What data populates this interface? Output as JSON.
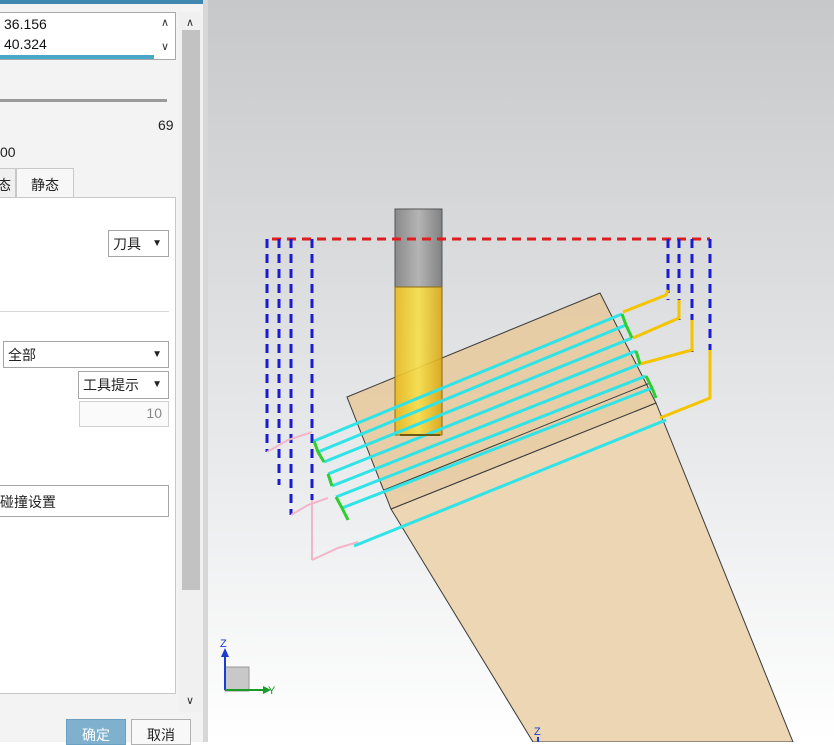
{
  "dialog": {
    "list_values": [
      "36.156",
      "40.324"
    ],
    "slider_value": "69",
    "value_00": "00",
    "tabs": [
      "态",
      "静态"
    ],
    "tool_select": "刀具",
    "filter_select": "全部",
    "tooltip_select": "工具提示",
    "number_field": "10",
    "collision_button": "碰撞设置",
    "ok_button": "确定",
    "cancel_button": "取消"
  },
  "viewport": {
    "triad_z": "Z",
    "triad_y": "Y",
    "bottom_z": "Z"
  },
  "colors": {
    "accent": "#49a8c9",
    "tool_yellow": "#f2d23a",
    "tool_gray": "#9e9e9e",
    "toolpath_cyan": "#33e6e6",
    "rapid_blue": "#1e1ecc",
    "rapid_red": "#e01c1c",
    "engage_yellow": "#f5c400",
    "workpiece": "#e8d2b0"
  }
}
